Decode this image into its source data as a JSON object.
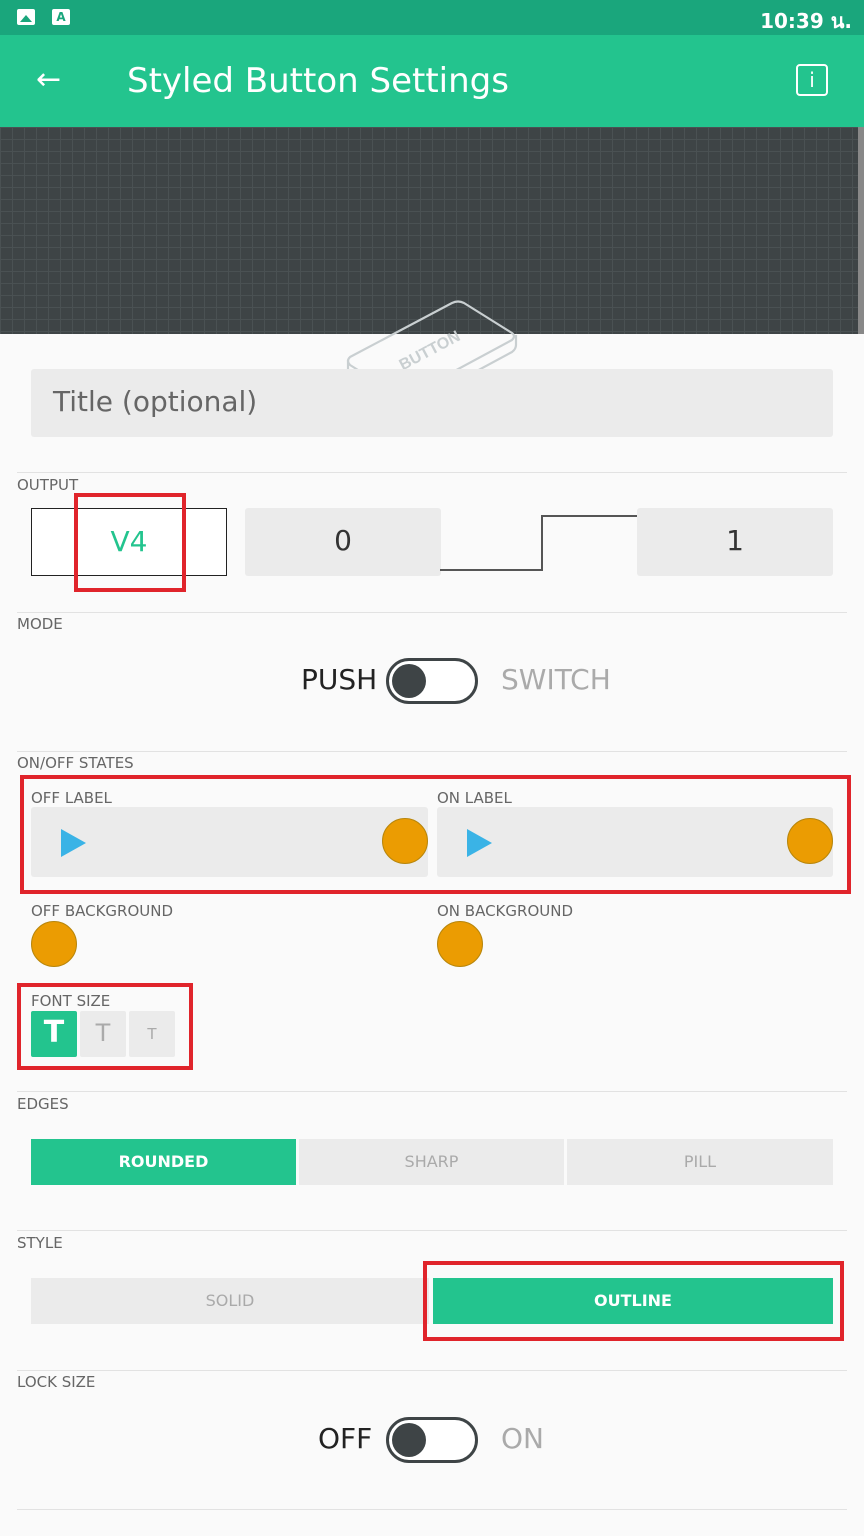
{
  "status": {
    "time": "10:39 น.",
    "icon_a": "A"
  },
  "appbar": {
    "back": "←",
    "title": "Styled Button Settings",
    "info": "i"
  },
  "hero": {
    "label": "BUTTON"
  },
  "title_field": {
    "placeholder": "Title (optional)"
  },
  "output": {
    "section": "OUTPUT",
    "pin": "V4",
    "min": "0",
    "max": "1"
  },
  "mode": {
    "section": "MODE",
    "left": "PUSH",
    "right": "SWITCH",
    "state": "PUSH"
  },
  "states": {
    "section": "ON/OFF STATES",
    "off_label": "OFF LABEL",
    "on_label": "ON LABEL",
    "off_background": "OFF BACKGROUND",
    "on_background": "ON BACKGROUND",
    "color_orange": "#eb9c02",
    "icon_play": "play-icon"
  },
  "font_size": {
    "section": "FONT SIZE",
    "options": [
      "T",
      "T",
      "T"
    ],
    "selected": 0
  },
  "edges": {
    "section": "EDGES",
    "options": [
      "ROUNDED",
      "SHARP",
      "PILL"
    ],
    "selected": "ROUNDED"
  },
  "style": {
    "section": "STYLE",
    "options": [
      "SOLID",
      "OUTLINE"
    ],
    "selected": "OUTLINE"
  },
  "lock_size": {
    "section": "LOCK SIZE",
    "left": "OFF",
    "right": "ON",
    "state": "OFF"
  },
  "colors": {
    "accent": "#23c48e",
    "status_bar": "#1aa67c",
    "highlight": "#e0242b",
    "dark": "#3e4446"
  }
}
